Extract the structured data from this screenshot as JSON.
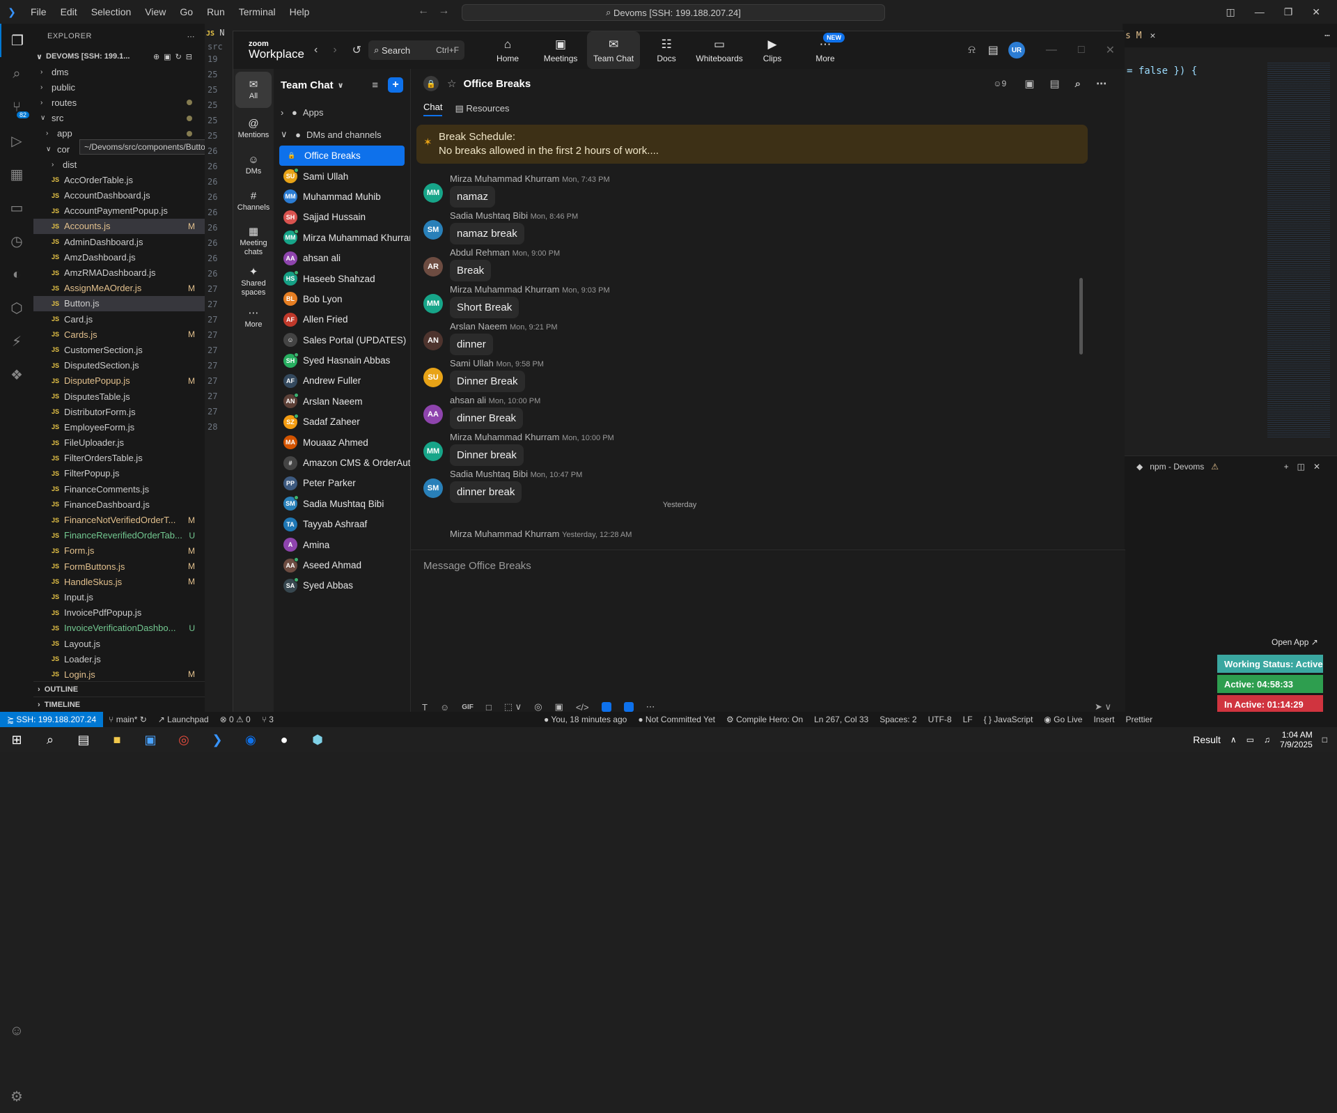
{
  "vscode": {
    "menu": [
      "File",
      "Edit",
      "Selection",
      "View",
      "Go",
      "Run",
      "Terminal",
      "Help"
    ],
    "search_text": "Devoms [SSH: 199.188.207.24]",
    "explorer": {
      "title": "EXPLORER",
      "project": "DEVOMS [SSH: 199.1...",
      "tooltip": "~/Devoms/src/components/Button.js",
      "rows": [
        {
          "type": "folder",
          "name": "dms",
          "indent": 1,
          "open": false
        },
        {
          "type": "folder",
          "name": "public",
          "indent": 1,
          "open": false
        },
        {
          "type": "folder",
          "name": "routes",
          "indent": 1,
          "open": false,
          "dot": true
        },
        {
          "type": "folder",
          "name": "src",
          "indent": 1,
          "open": true,
          "dot": true
        },
        {
          "type": "folder",
          "name": "app",
          "indent": 2,
          "open": false,
          "dot": true
        },
        {
          "type": "folder",
          "name": "cor",
          "indent": 2,
          "open": true
        },
        {
          "type": "folder",
          "name": "dist",
          "indent": 3,
          "open": false
        },
        {
          "type": "file",
          "name": "AccOrderTable.js"
        },
        {
          "type": "file",
          "name": "AccountDashboard.js"
        },
        {
          "type": "file",
          "name": "AccountPaymentPopup.js"
        },
        {
          "type": "file",
          "name": "Accounts.js",
          "status": "M",
          "selected": true
        },
        {
          "type": "file",
          "name": "AdminDashboard.js"
        },
        {
          "type": "file",
          "name": "AmzDashboard.js"
        },
        {
          "type": "file",
          "name": "AmzRMADashboard.js"
        },
        {
          "type": "file",
          "name": "AssignMeAOrder.js",
          "status": "M"
        },
        {
          "type": "file",
          "name": "Button.js",
          "selected": true
        },
        {
          "type": "file",
          "name": "Card.js"
        },
        {
          "type": "file",
          "name": "Cards.js",
          "status": "M"
        },
        {
          "type": "file",
          "name": "CustomerSection.js"
        },
        {
          "type": "file",
          "name": "DisputedSection.js"
        },
        {
          "type": "file",
          "name": "DisputePopup.js",
          "status": "M"
        },
        {
          "type": "file",
          "name": "DisputesTable.js"
        },
        {
          "type": "file",
          "name": "DistributorForm.js"
        },
        {
          "type": "file",
          "name": "EmployeeForm.js"
        },
        {
          "type": "file",
          "name": "FileUploader.js"
        },
        {
          "type": "file",
          "name": "FilterOrdersTable.js"
        },
        {
          "type": "file",
          "name": "FilterPopup.js"
        },
        {
          "type": "file",
          "name": "FinanceComments.js"
        },
        {
          "type": "file",
          "name": "FinanceDashboard.js"
        },
        {
          "type": "file",
          "name": "FinanceNotVerifiedOrderT...",
          "status": "M"
        },
        {
          "type": "file",
          "name": "FinanceReverifiedOrderTab...",
          "status": "U"
        },
        {
          "type": "file",
          "name": "Form.js",
          "status": "M"
        },
        {
          "type": "file",
          "name": "FormButtons.js",
          "status": "M"
        },
        {
          "type": "file",
          "name": "HandleSkus.js",
          "status": "M"
        },
        {
          "type": "file",
          "name": "Input.js"
        },
        {
          "type": "file",
          "name": "InvoicePdfPopup.js"
        },
        {
          "type": "file",
          "name": "InvoiceVerificationDashbo...",
          "status": "U"
        },
        {
          "type": "file",
          "name": "Layout.js"
        },
        {
          "type": "file",
          "name": "Loader.js"
        },
        {
          "type": "file",
          "name": "Login.js",
          "status": "M"
        }
      ],
      "outline": "OUTLINE",
      "timeline": "TIMELINE"
    },
    "editor_code_right": "= false }) {",
    "terminal_label": "npm - Devoms",
    "line_numbers": [
      "19",
      "25",
      "25",
      "25",
      "25",
      "25",
      "26",
      "26",
      "26",
      "26",
      "26",
      "26",
      "26",
      "26",
      "26",
      "27",
      "27",
      "27",
      "27",
      "27",
      "27",
      "27",
      "27",
      "27",
      "28"
    ],
    "statusbar": {
      "ssh": "SSH: 199.188.207.24",
      "branch": "main*",
      "launchpad": "Launchpad",
      "problems": "0 ⚠ 0",
      "ports": "3",
      "blame": "You, 18 minutes ago",
      "commit": "Not Committed Yet",
      "compile": "Compile Hero: On",
      "position": "Ln 267, Col 33",
      "spaces": "Spaces: 2",
      "encoding": "UTF-8",
      "eol": "LF",
      "language": "JavaScript",
      "golive": "Go Live",
      "insert": "Insert",
      "prettier": "Prettier"
    }
  },
  "zoom": {
    "logo_top": "zoom",
    "logo_bottom": "Workplace",
    "search": "Search",
    "search_shortcut": "Ctrl+F",
    "tabs": [
      {
        "label": "Home",
        "icon": "⌂"
      },
      {
        "label": "Meetings",
        "icon": "▣"
      },
      {
        "label": "Team Chat",
        "icon": "✉",
        "active": true
      },
      {
        "label": "Docs",
        "icon": "☷"
      },
      {
        "label": "Whiteboards",
        "icon": "▭"
      },
      {
        "label": "Clips",
        "icon": "▶"
      },
      {
        "label": "More",
        "icon": "⋯",
        "badge": "NEW"
      }
    ],
    "user_initials": "UR",
    "rail": [
      {
        "label": "All",
        "icon": "✉",
        "active": true
      },
      {
        "label": "Mentions",
        "icon": "@"
      },
      {
        "label": "DMs",
        "icon": "☺"
      },
      {
        "label": "Channels",
        "icon": "#"
      },
      {
        "label": "Meeting chats",
        "icon": "▦"
      },
      {
        "label": "Shared spaces",
        "icon": "✦"
      },
      {
        "label": "More",
        "icon": "⋯"
      }
    ],
    "list": {
      "title": "Team Chat",
      "apps": "Apps",
      "dms_group": "DMs and channels",
      "items": [
        {
          "name": "Office Breaks",
          "initials": "🔒",
          "color": "#0e71eb",
          "active": true
        },
        {
          "name": "Sami Ullah",
          "initials": "SU",
          "color": "#e8a317",
          "online": true
        },
        {
          "name": "Muhammad Muhib",
          "initials": "MM",
          "color": "#2b7cd3"
        },
        {
          "name": "Sajjad Hussain",
          "initials": "SH",
          "color": "#d9534f"
        },
        {
          "name": "Mirza Muhammad Khurram",
          "initials": "MM",
          "color": "#17a589",
          "online": true
        },
        {
          "name": "ahsan ali",
          "initials": "AA",
          "color": "#8e44ad"
        },
        {
          "name": "Haseeb Shahzad",
          "initials": "HS",
          "color": "#16a085",
          "online": true
        },
        {
          "name": "Bob Lyon",
          "initials": "BL",
          "color": "#e67e22"
        },
        {
          "name": "Allen Fried",
          "initials": "AF",
          "color": "#c0392b"
        },
        {
          "name": "Sales Portal (UPDATES)",
          "initials": "☺",
          "color": "#444"
        },
        {
          "name": "Syed Hasnain Abbas",
          "initials": "SH",
          "color": "#27ae60",
          "online": true
        },
        {
          "name": "Andrew Fuller",
          "initials": "AF",
          "color": "#34495e"
        },
        {
          "name": "Arslan Naeem",
          "initials": "AN",
          "color": "#5d4037",
          "online": true
        },
        {
          "name": "Sadaf Zaheer",
          "initials": "SZ",
          "color": "#f39c12",
          "online": true
        },
        {
          "name": "Mouaaz Ahmed",
          "initials": "MA",
          "color": "#d35400"
        },
        {
          "name": "Amazon CMS & OrderAuto...",
          "initials": "#",
          "color": "#444"
        },
        {
          "name": "Peter Parker",
          "initials": "PP",
          "color": "#3d5a80"
        },
        {
          "name": "Sadia Mushtaq Bibi",
          "initials": "SM",
          "color": "#2980b9",
          "online": true
        },
        {
          "name": "Tayyab Ashraaf",
          "initials": "TA",
          "color": "#1f77b4"
        },
        {
          "name": "Amina",
          "initials": "A",
          "color": "#8e44ad"
        },
        {
          "name": "Aseed Ahmad",
          "initials": "AA",
          "color": "#6d4c41",
          "online": true
        },
        {
          "name": "Syed Abbas",
          "initials": "SA",
          "color": "#37474f",
          "online": true
        }
      ]
    },
    "chat": {
      "title": "Office Breaks",
      "members": "9",
      "subtabs": [
        "Chat",
        "Resources"
      ],
      "pinned_title": "Break Schedule:",
      "pinned_text": "No breaks allowed in the first 2 hours of work....",
      "messages": [
        {
          "author": "Mirza Muhammad Khurram",
          "time": "Mon, 7:43 PM",
          "text": "namaz",
          "initials": "MM",
          "color": "#17a589"
        },
        {
          "author": "Sadia Mushtaq Bibi",
          "time": "Mon, 8:46 PM",
          "text": "namaz break",
          "initials": "SM",
          "color": "#2980b9"
        },
        {
          "author": "Abdul Rehman",
          "time": "Mon, 9:00 PM",
          "text": "Break",
          "initials": "AR",
          "color": "#6d4c41"
        },
        {
          "author": "Mirza Muhammad Khurram",
          "time": "Mon, 9:03 PM",
          "text": "Short Break",
          "initials": "MM",
          "color": "#17a589"
        },
        {
          "author": "Arslan Naeem",
          "time": "Mon, 9:21 PM",
          "text": "dinner",
          "initials": "AN",
          "color": "#4e342e"
        },
        {
          "author": "Sami Ullah",
          "time": "Mon, 9:58 PM",
          "text": "Dinner Break",
          "initials": "SU",
          "color": "#e8a317"
        },
        {
          "author": "ahsan ali",
          "time": "Mon, 10:00 PM",
          "text": "dinner Break",
          "initials": "AA",
          "color": "#8e44ad"
        },
        {
          "author": "Mirza Muhammad Khurram",
          "time": "Mon, 10:00 PM",
          "text": "Dinner break",
          "initials": "MM",
          "color": "#17a589"
        },
        {
          "author": "Sadia Mushtaq Bibi",
          "time": "Mon, 10:47 PM",
          "text": "dinner break",
          "initials": "SM",
          "color": "#2980b9"
        }
      ],
      "day_separator": "Yesterday",
      "last_author": "Mirza Muhammad Khurram",
      "last_time": "Yesterday, 12:28 AM",
      "composer_placeholder": "Message Office Breaks"
    }
  },
  "working_status": {
    "open_app": "Open App ↗",
    "status": "Working Status: Active",
    "active": "Active: 04:58:33",
    "inactive": "In Active: 01:14:29",
    "colors": {
      "status": "#3aa7a0",
      "active": "#2e9e4f",
      "inactive": "#d0343f"
    }
  },
  "taskbar": {
    "result": "Result",
    "time": "1:04 AM",
    "date": "7/9/2025"
  }
}
